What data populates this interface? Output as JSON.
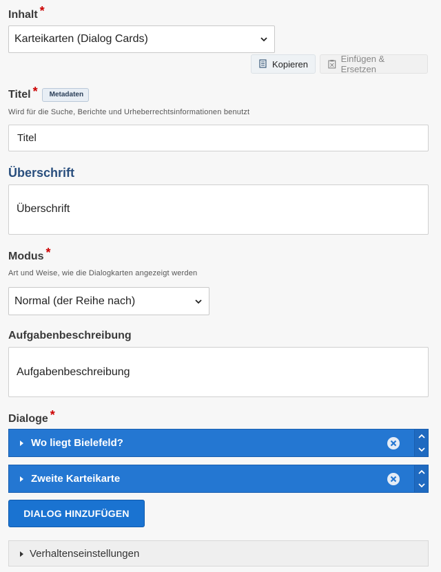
{
  "inhalt": {
    "label": "Inhalt",
    "required": "*",
    "selected": "Karteikarten (Dialog Cards)",
    "copy_label": "Kopieren",
    "paste_label": "Einfügen & Ersetzen"
  },
  "titel": {
    "label": "Titel",
    "required": "*",
    "tag": "Metadaten",
    "description": "Wird für die Suche, Berichte und Urheberrechtsinformationen benutzt",
    "value": "Titel"
  },
  "ueberschrift": {
    "label": "Überschrift",
    "value": "Überschrift"
  },
  "modus": {
    "label": "Modus",
    "required": "*",
    "description": "Art und Weise, wie die Dialogkarten angezeigt werden",
    "selected": "Normal (der Reihe nach)"
  },
  "aufgabe": {
    "label": "Aufgabenbeschreibung",
    "value": "Aufgabenbeschreibung"
  },
  "dialoge": {
    "label": "Dialoge",
    "required": "*",
    "items": [
      {
        "title": "Wo liegt Bielefeld?"
      },
      {
        "title": "Zweite Karteikarte"
      }
    ],
    "add_label": "DIALOG HINZUFÜGEN"
  },
  "verhalten": {
    "label": "Verhaltenseinstellungen"
  },
  "colors": {
    "accent_blue": "#2477d2",
    "required_red": "#cc0000",
    "heading_blue": "#2a4f7e"
  }
}
